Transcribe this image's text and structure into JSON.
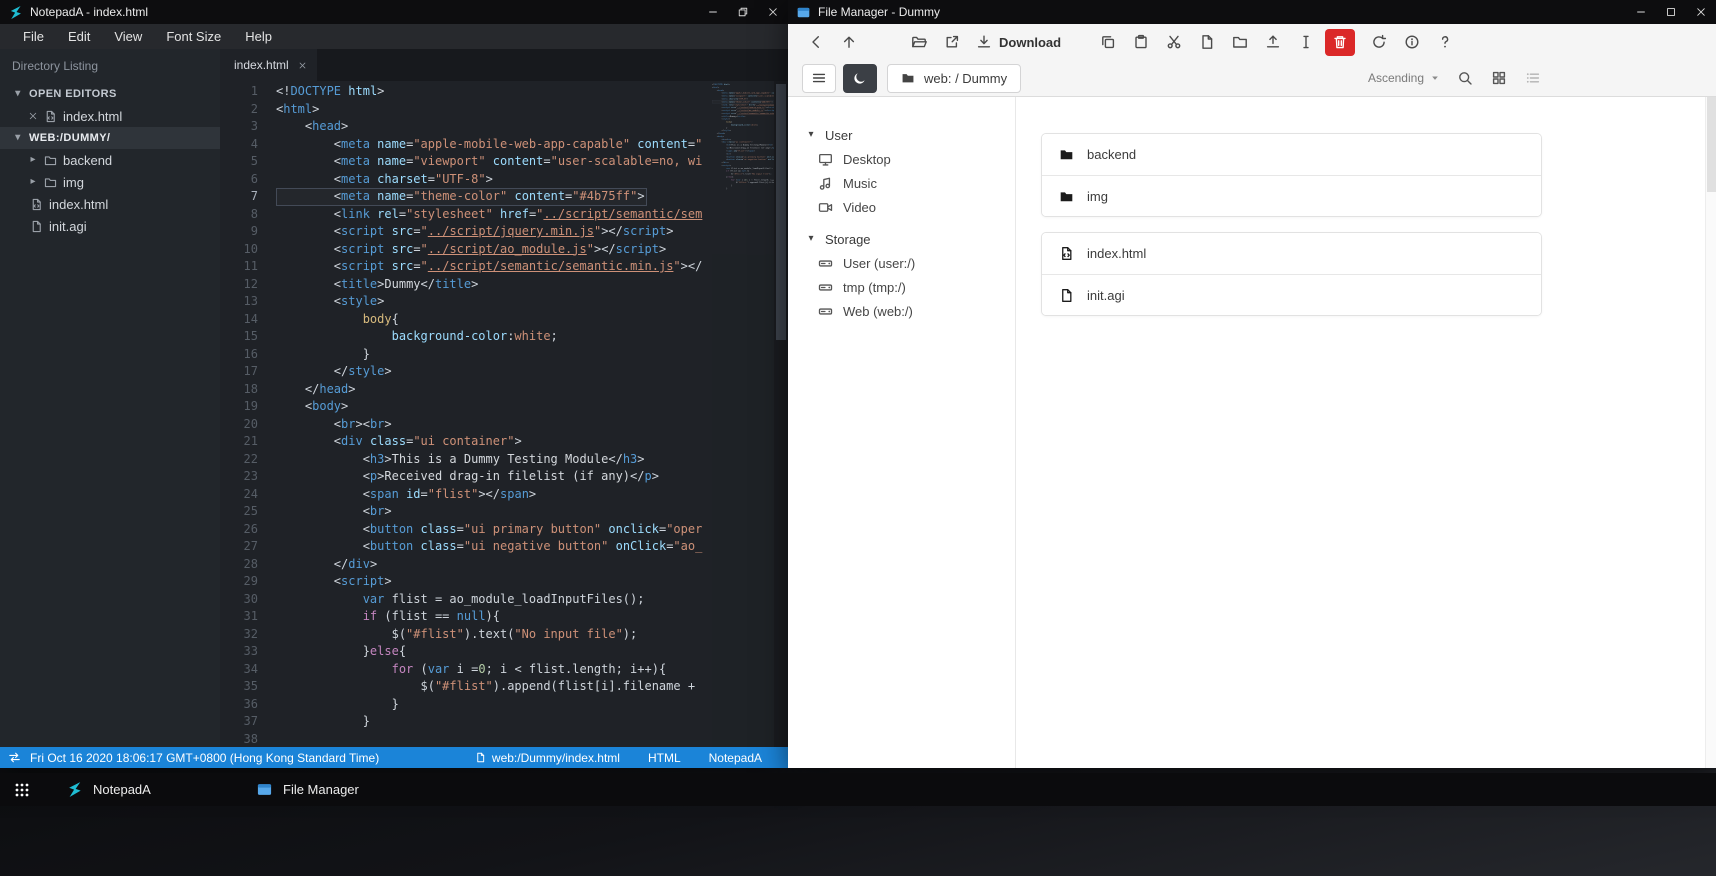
{
  "notepad": {
    "window_title": "NotepadA - index.html",
    "menus": [
      "File",
      "Edit",
      "View",
      "Font Size",
      "Help"
    ],
    "sidebar": {
      "header": "Directory Listing",
      "open_editors_label": "OPEN EDITORS",
      "open_editors": [
        {
          "name": "index.html",
          "icon": "file-code"
        }
      ],
      "workspace_label": "WEB:/DUMMY/",
      "tree": [
        {
          "name": "backend",
          "type": "folder",
          "icon": "folder"
        },
        {
          "name": "img",
          "type": "folder",
          "icon": "folder"
        },
        {
          "name": "index.html",
          "type": "file",
          "icon": "file-code"
        },
        {
          "name": "init.agi",
          "type": "file",
          "icon": "file"
        }
      ]
    },
    "tab": {
      "label": "index.html"
    },
    "code": {
      "active_line": 7,
      "lines": [
        [
          [
            "p",
            "<!"
          ],
          [
            "tag",
            "DOCTYPE"
          ],
          [
            "p",
            " "
          ],
          [
            "attr",
            "html"
          ],
          [
            "p",
            ">"
          ]
        ],
        [
          [
            "p",
            "<"
          ],
          [
            "tag",
            "html"
          ],
          [
            "p",
            ">"
          ]
        ],
        [
          [
            "p",
            "    <"
          ],
          [
            "tag",
            "head"
          ],
          [
            "p",
            ">"
          ]
        ],
        [
          [
            "p",
            "        <"
          ],
          [
            "tag",
            "meta"
          ],
          [
            "p",
            " "
          ],
          [
            "attr",
            "name"
          ],
          [
            "p",
            "="
          ],
          [
            "str",
            "\"apple-mobile-web-app-capable\""
          ],
          [
            "p",
            " "
          ],
          [
            "attr",
            "content"
          ],
          [
            "p",
            "="
          ],
          [
            "str",
            "\""
          ]
        ],
        [
          [
            "p",
            "        <"
          ],
          [
            "tag",
            "meta"
          ],
          [
            "p",
            " "
          ],
          [
            "attr",
            "name"
          ],
          [
            "p",
            "="
          ],
          [
            "str",
            "\"viewport\""
          ],
          [
            "p",
            " "
          ],
          [
            "attr",
            "content"
          ],
          [
            "p",
            "="
          ],
          [
            "str",
            "\"user-scalable=no, wi"
          ]
        ],
        [
          [
            "p",
            "        <"
          ],
          [
            "tag",
            "meta"
          ],
          [
            "p",
            " "
          ],
          [
            "attr",
            "charset"
          ],
          [
            "p",
            "="
          ],
          [
            "str",
            "\"UTF-8\""
          ],
          [
            "p",
            ">"
          ]
        ],
        [
          [
            "p",
            "        <"
          ],
          [
            "tag",
            "meta"
          ],
          [
            "p",
            " "
          ],
          [
            "attr",
            "name"
          ],
          [
            "p",
            "="
          ],
          [
            "str",
            "\"theme-color\""
          ],
          [
            "p",
            " "
          ],
          [
            "attr",
            "content"
          ],
          [
            "p",
            "="
          ],
          [
            "str",
            "\"#4b75ff\""
          ],
          [
            "p",
            ">"
          ]
        ],
        [
          [
            "p",
            "        <"
          ],
          [
            "tag",
            "link"
          ],
          [
            "p",
            " "
          ],
          [
            "attr",
            "rel"
          ],
          [
            "p",
            "="
          ],
          [
            "str",
            "\"stylesheet\""
          ],
          [
            "p",
            " "
          ],
          [
            "attr",
            "href"
          ],
          [
            "p",
            "="
          ],
          [
            "str",
            "\""
          ],
          [
            "stru",
            "../script/semantic/sem"
          ]
        ],
        [
          [
            "p",
            "        <"
          ],
          [
            "tag",
            "script"
          ],
          [
            "p",
            " "
          ],
          [
            "attr",
            "src"
          ],
          [
            "p",
            "="
          ],
          [
            "str",
            "\""
          ],
          [
            "stru",
            "../script/jquery.min.js"
          ],
          [
            "str",
            "\""
          ],
          [
            "p",
            "></"
          ],
          [
            "tag",
            "script"
          ],
          [
            "p",
            ">"
          ]
        ],
        [
          [
            "p",
            "        <"
          ],
          [
            "tag",
            "script"
          ],
          [
            "p",
            " "
          ],
          [
            "attr",
            "src"
          ],
          [
            "p",
            "="
          ],
          [
            "str",
            "\""
          ],
          [
            "stru",
            "../script/ao_module.js"
          ],
          [
            "str",
            "\""
          ],
          [
            "p",
            "></"
          ],
          [
            "tag",
            "script"
          ],
          [
            "p",
            ">"
          ]
        ],
        [
          [
            "p",
            "        <"
          ],
          [
            "tag",
            "script"
          ],
          [
            "p",
            " "
          ],
          [
            "attr",
            "src"
          ],
          [
            "p",
            "="
          ],
          [
            "str",
            "\""
          ],
          [
            "stru",
            "../script/semantic/semantic.min.js"
          ],
          [
            "str",
            "\""
          ],
          [
            "p",
            "></"
          ]
        ],
        [
          [
            "p",
            "        <"
          ],
          [
            "tag",
            "title"
          ],
          [
            "p",
            ">"
          ],
          [
            "txt",
            "Dummy"
          ],
          [
            "p",
            "</"
          ],
          [
            "tag",
            "title"
          ],
          [
            "p",
            ">"
          ]
        ],
        [
          [
            "p",
            "        <"
          ],
          [
            "tag",
            "style"
          ],
          [
            "p",
            ">"
          ]
        ],
        [
          [
            "p",
            "            "
          ],
          [
            "sel",
            "body"
          ],
          [
            "p",
            "{"
          ]
        ],
        [
          [
            "p",
            "                "
          ],
          [
            "attr",
            "background-color"
          ],
          [
            "p",
            ":"
          ],
          [
            "str",
            "white"
          ],
          [
            "p",
            ";"
          ]
        ],
        [
          [
            "p",
            "            }"
          ]
        ],
        [
          [
            "p",
            "        </"
          ],
          [
            "tag",
            "style"
          ],
          [
            "p",
            ">"
          ]
        ],
        [
          [
            "p",
            "    </"
          ],
          [
            "tag",
            "head"
          ],
          [
            "p",
            ">"
          ]
        ],
        [
          [
            "p",
            "    <"
          ],
          [
            "tag",
            "body"
          ],
          [
            "p",
            ">"
          ]
        ],
        [
          [
            "p",
            "        <"
          ],
          [
            "tag",
            "br"
          ],
          [
            "p",
            "><"
          ],
          [
            "tag",
            "br"
          ],
          [
            "p",
            ">"
          ]
        ],
        [
          [
            "p",
            "        <"
          ],
          [
            "tag",
            "div"
          ],
          [
            "p",
            " "
          ],
          [
            "attr",
            "class"
          ],
          [
            "p",
            "="
          ],
          [
            "str",
            "\"ui container\""
          ],
          [
            "p",
            ">"
          ]
        ],
        [
          [
            "p",
            "            <"
          ],
          [
            "tag",
            "h3"
          ],
          [
            "p",
            ">"
          ],
          [
            "txt",
            "This is a Dummy Testing Module"
          ],
          [
            "p",
            "</"
          ],
          [
            "tag",
            "h3"
          ],
          [
            "p",
            ">"
          ]
        ],
        [
          [
            "p",
            "            <"
          ],
          [
            "tag",
            "p"
          ],
          [
            "p",
            ">"
          ],
          [
            "txt",
            "Received drag-in filelist (if any)"
          ],
          [
            "p",
            "</"
          ],
          [
            "tag",
            "p"
          ],
          [
            "p",
            ">"
          ]
        ],
        [
          [
            "p",
            "            <"
          ],
          [
            "tag",
            "span"
          ],
          [
            "p",
            " "
          ],
          [
            "attr",
            "id"
          ],
          [
            "p",
            "="
          ],
          [
            "str",
            "\"flist\""
          ],
          [
            "p",
            "></"
          ],
          [
            "tag",
            "span"
          ],
          [
            "p",
            ">"
          ]
        ],
        [
          [
            "p",
            "            <"
          ],
          [
            "tag",
            "br"
          ],
          [
            "p",
            ">"
          ]
        ],
        [
          [
            "p",
            "            <"
          ],
          [
            "tag",
            "button"
          ],
          [
            "p",
            " "
          ],
          [
            "attr",
            "class"
          ],
          [
            "p",
            "="
          ],
          [
            "str",
            "\"ui primary button\""
          ],
          [
            "p",
            " "
          ],
          [
            "attr",
            "onclick"
          ],
          [
            "p",
            "="
          ],
          [
            "str",
            "\"oper"
          ]
        ],
        [
          [
            "p",
            "            <"
          ],
          [
            "tag",
            "button"
          ],
          [
            "p",
            " "
          ],
          [
            "attr",
            "class"
          ],
          [
            "p",
            "="
          ],
          [
            "str",
            "\"ui negative button\""
          ],
          [
            "p",
            " "
          ],
          [
            "attr",
            "onClick"
          ],
          [
            "p",
            "="
          ],
          [
            "str",
            "\"ao_"
          ]
        ],
        [
          [
            "p",
            "        </"
          ],
          [
            "tag",
            "div"
          ],
          [
            "p",
            ">"
          ]
        ],
        [
          [
            "p",
            "        <"
          ],
          [
            "tag",
            "script"
          ],
          [
            "p",
            ">"
          ]
        ],
        [
          [
            "p",
            "            "
          ],
          [
            "kw",
            "var"
          ],
          [
            "p",
            " flist = ao_module_loadInputFiles();"
          ]
        ],
        [
          [
            "p",
            "            "
          ],
          [
            "ctl",
            "if"
          ],
          [
            "p",
            " (flist == "
          ],
          [
            "kw",
            "null"
          ],
          [
            "p",
            "){"
          ]
        ],
        [
          [
            "p",
            "                $("
          ],
          [
            "str",
            "\"#flist\""
          ],
          [
            "p",
            ").text("
          ],
          [
            "str",
            "\"No input file\""
          ],
          [
            "p",
            ");"
          ]
        ],
        [
          [
            "p",
            "            }"
          ],
          [
            "ctl",
            "else"
          ],
          [
            "p",
            "{"
          ]
        ],
        [
          [
            "p",
            "                "
          ],
          [
            "ctl",
            "for"
          ],
          [
            "p",
            " ("
          ],
          [
            "kw",
            "var"
          ],
          [
            "p",
            " i ="
          ],
          [
            "num",
            "0"
          ],
          [
            "p",
            "; i < flist.length; i++){"
          ]
        ],
        [
          [
            "p",
            "                    $("
          ],
          [
            "str",
            "\"#flist\""
          ],
          [
            "p",
            ").append(flist[i].filename + "
          ]
        ],
        [
          [
            "p",
            "                }"
          ]
        ],
        [
          [
            "p",
            "            }"
          ]
        ],
        [
          [
            "p",
            ""
          ]
        ]
      ]
    },
    "statusbar": {
      "datetime": "Fri Oct 16 2020 18:06:17 GMT+0800 (Hong Kong Standard Time)",
      "path": "web:/Dummy/index.html",
      "language": "HTML",
      "app": "NotepadA"
    }
  },
  "filemanager": {
    "window_title": "File Manager - Dummy",
    "toolbar": {
      "groups": [
        {
          "buttons": [
            {
              "name": "back",
              "icon": "arrow-left"
            },
            {
              "name": "up",
              "icon": "arrow-up"
            }
          ]
        },
        {
          "buttons": [
            {
              "name": "open",
              "icon": "folder-open"
            },
            {
              "name": "open-in-new",
              "icon": "external-link"
            },
            {
              "name": "download",
              "icon": "download",
              "label": "Download"
            }
          ]
        },
        {
          "buttons": [
            {
              "name": "copy",
              "icon": "copy"
            },
            {
              "name": "paste",
              "icon": "paste"
            },
            {
              "name": "cut",
              "icon": "cut"
            },
            {
              "name": "new-file",
              "icon": "new-file"
            },
            {
              "name": "new-folder",
              "icon": "folder"
            },
            {
              "name": "upload",
              "icon": "upload"
            },
            {
              "name": "rename",
              "icon": "rename"
            },
            {
              "name": "delete",
              "icon": "trash",
              "style": "danger"
            }
          ]
        },
        {
          "buttons": [
            {
              "name": "refresh",
              "icon": "refresh"
            },
            {
              "name": "info",
              "icon": "info"
            },
            {
              "name": "help",
              "icon": "help"
            }
          ]
        }
      ]
    },
    "nav": {
      "breadcrumb": "web: / Dummy",
      "sort_label": "Ascending"
    },
    "sidebar": {
      "sections": [
        {
          "label": "User",
          "items": [
            {
              "label": "Desktop",
              "icon": "desktop"
            },
            {
              "label": "Music",
              "icon": "music"
            },
            {
              "label": "Video",
              "icon": "video"
            }
          ]
        },
        {
          "label": "Storage",
          "items": [
            {
              "label": "User (user:/)",
              "icon": "drive"
            },
            {
              "label": "tmp (tmp:/)",
              "icon": "drive"
            },
            {
              "label": "Web (web:/)",
              "icon": "drive"
            }
          ]
        }
      ]
    },
    "file_groups": [
      {
        "items": [
          {
            "name": "backend",
            "icon": "folder-solid"
          },
          {
            "name": "img",
            "icon": "folder-solid"
          }
        ]
      },
      {
        "items": [
          {
            "name": "index.html",
            "icon": "file-code"
          },
          {
            "name": "init.agi",
            "icon": "file"
          }
        ]
      }
    ]
  },
  "taskbar": {
    "items": [
      {
        "label": "NotepadA",
        "icon": "notepada-logo"
      },
      {
        "label": "File Manager",
        "icon": "fm-logo"
      }
    ]
  },
  "colors": {
    "statusbar_blue": "#1b84d8",
    "danger_red": "#db2828",
    "notepada_teal": "#1fbcd2",
    "filemanager_blue": "#57a8ea"
  }
}
